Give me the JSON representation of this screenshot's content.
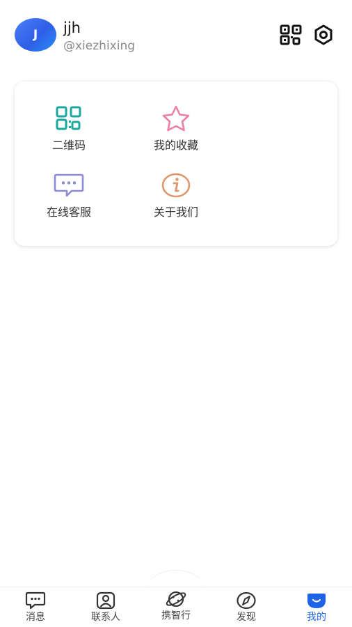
{
  "header": {
    "avatar_initial": "J",
    "username": "jjh",
    "handle": "@xiezhixing",
    "qr_icon": "qr-code-icon",
    "settings_icon": "settings-hexagon-icon"
  },
  "menu": {
    "items": [
      {
        "label": "二维码",
        "icon": "qr-code-icon",
        "color": "#1aa9a0"
      },
      {
        "label": "我的收藏",
        "icon": "star-icon",
        "color": "#ea7fa8"
      },
      {
        "label": "在线客服",
        "icon": "chat-bubble-icon",
        "color": "#8d8bd3"
      },
      {
        "label": "关于我们",
        "icon": "info-icon",
        "color": "#e1956c"
      }
    ]
  },
  "bottom_nav": {
    "items": [
      {
        "label": "消息",
        "icon": "message-icon",
        "active": false
      },
      {
        "label": "联系人",
        "icon": "contacts-icon",
        "active": false
      },
      {
        "label": "携智行",
        "icon": "planet-icon",
        "active": false
      },
      {
        "label": "发现",
        "icon": "compass-icon",
        "active": false
      },
      {
        "label": "我的",
        "icon": "profile-icon",
        "active": true
      }
    ],
    "active_color": "#1e63e6"
  }
}
